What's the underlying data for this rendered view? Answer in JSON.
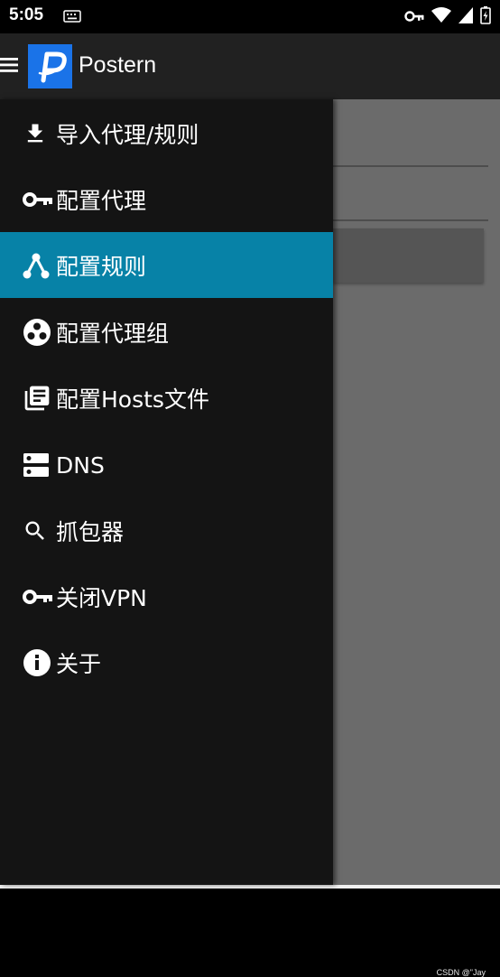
{
  "status_bar": {
    "time": "5:05",
    "icons": [
      "keyboard-icon",
      "vpn-key-icon",
      "wifi-icon",
      "signal-icon",
      "battery-icon"
    ]
  },
  "app_bar": {
    "title": "Postern",
    "logo_letter": "P",
    "logo_color": "#1a73e8",
    "background": "#212121"
  },
  "drawer": {
    "background": "#141414",
    "selected_color": "#0782a7",
    "items": [
      {
        "label": "导入代理/规则",
        "icon": "download-icon",
        "selected": false
      },
      {
        "label": "配置代理",
        "icon": "key-icon",
        "selected": false
      },
      {
        "label": "配置规则",
        "icon": "fork-icon",
        "selected": true
      },
      {
        "label": "配置代理组",
        "icon": "group-dots-icon",
        "selected": false
      },
      {
        "label": "配置Hosts文件",
        "icon": "library-books-icon",
        "selected": false
      },
      {
        "label": "DNS",
        "icon": "dns-icon",
        "selected": false
      },
      {
        "label": "抓包器",
        "icon": "search-icon",
        "selected": false
      },
      {
        "label": "关闭VPN",
        "icon": "key-icon",
        "selected": false
      },
      {
        "label": "关于",
        "icon": "info-icon",
        "selected": false
      }
    ]
  },
  "watermark": "CSDN @\"Jay"
}
